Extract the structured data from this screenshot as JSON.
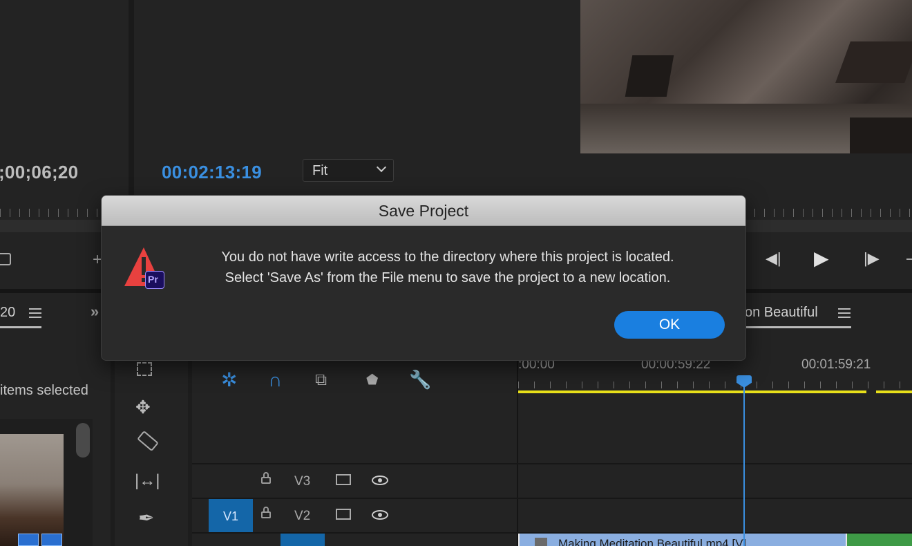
{
  "source_monitor": {
    "timecode": ";00;06;20"
  },
  "program_monitor": {
    "timecode": "00:02:13:19",
    "zoom_select": "Fit"
  },
  "dialog": {
    "title": "Save Project",
    "message_line1": "You do not have write access to the directory where this project is located.",
    "message_line2": "Select 'Save As' from the File menu to save the project to a new location.",
    "ok_label": "OK",
    "app_badge": "Pr"
  },
  "project_panel": {
    "tab_label": "20",
    "status": "items selected"
  },
  "timeline": {
    "tab_label": "on Beautiful",
    "ruler_labels": [
      ":00:00",
      "00:00:59:22",
      "00:01:59:21"
    ],
    "tracks": [
      {
        "source": "",
        "target": "V3"
      },
      {
        "source": "V1",
        "target": "V2"
      }
    ],
    "clip_label": "Making Meditation Beautiful.mp4 [V]"
  },
  "colors": {
    "accent": "#1a7fe0",
    "timecode": "#3a8fe0",
    "work_area": "#e8e01a",
    "clip": "#8aaee0"
  }
}
